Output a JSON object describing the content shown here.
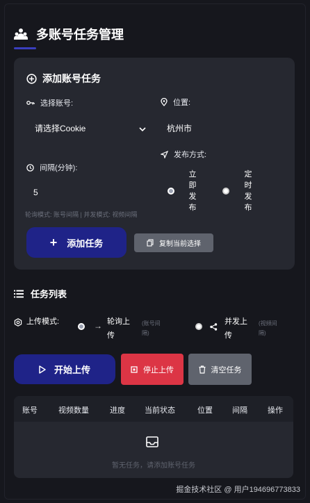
{
  "header": {
    "title": "多账号任务管理"
  },
  "add_task": {
    "title": "添加账号任务",
    "account_label": "选择账号:",
    "account_value": "请选择Cookie",
    "location_label": "位置:",
    "location_value": "杭州市",
    "interval_label": "间隔(分钟):",
    "interval_value": "5",
    "publish_label": "发布方式:",
    "publish_options": [
      "立即发布",
      "定时发布"
    ],
    "publish_selected": "立即发布",
    "hint": "轮询模式: 账号间隔 | 并发模式: 视频间隔",
    "add_button": "添加任务",
    "copy_button": "复制当前选择"
  },
  "task_list": {
    "title": "任务列表",
    "upload_mode_label": "上传模式:",
    "modes": [
      {
        "label": "轮询上传",
        "sub": "(账号间隔)"
      },
      {
        "label": "并发上传",
        "sub": "(视频间隔)"
      }
    ],
    "mode_selected": "轮询上传",
    "start_button": "开始上传",
    "stop_button": "停止上传",
    "clear_button": "清空任务",
    "columns": [
      "账号",
      "视频数量",
      "进度",
      "当前状态",
      "位置",
      "间隔",
      "操作"
    ],
    "empty_text": "暂无任务，请添加账号任务"
  },
  "watermark": "掘金技术社区 @ 用户194696773833"
}
